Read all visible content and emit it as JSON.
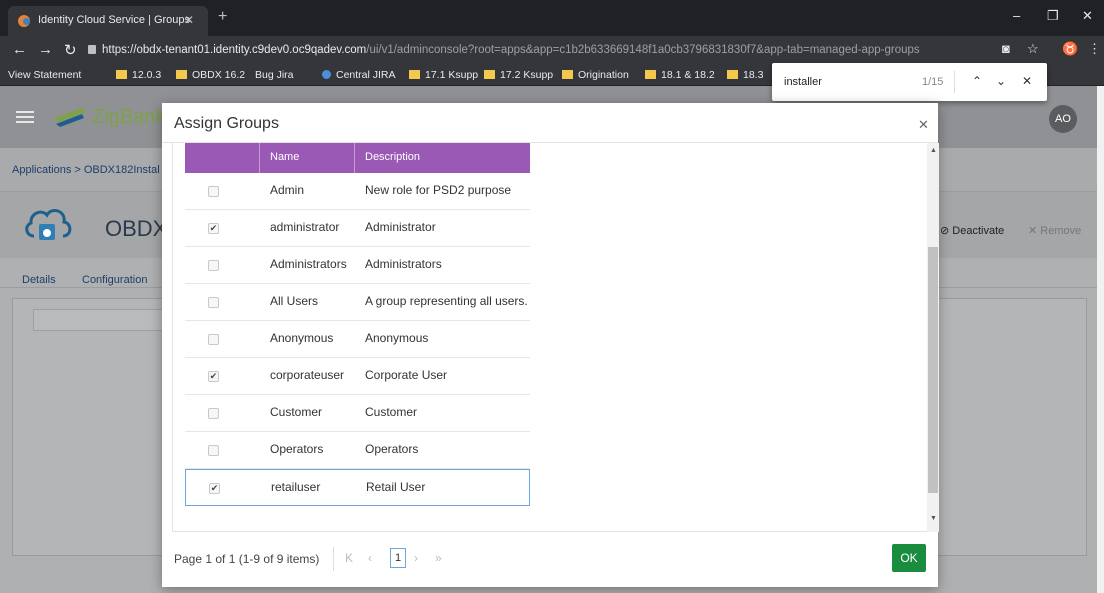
{
  "browser": {
    "tab_title": "Identity Cloud Service | Groups",
    "url_host": "https://obdx-tenant01.identity.c9dev0.oc9qadev.com",
    "url_path": "/ui/v1/adminconsole?root=apps&app=c1b2b633669148f1a0cb3796831830f7&app-tab=managed-app-groups",
    "bookmarks": [
      "View Statement",
      "12.0.3",
      "OBDX 16.2",
      "Bug Jira",
      "Central JIRA",
      "17.1 Ksupp",
      "17.2 Ksupp",
      "Origination",
      "18.1 & 18.2",
      "18.3"
    ],
    "find_query": "installer",
    "find_count": "1/15"
  },
  "app": {
    "logo_text": "ZigBank",
    "avatar": "AO",
    "breadcrumb": "Applications > OBDX182Instal",
    "app_title": "OBDX",
    "deactivate_label": "Deactivate",
    "remove_label": "Remove",
    "tabs": [
      "Details",
      "Configuration"
    ]
  },
  "modal": {
    "title": "Assign Groups",
    "columns": {
      "name": "Name",
      "description": "Description"
    },
    "rows": [
      {
        "name": "Admin",
        "description": "New role for PSD2 purpose",
        "checked": false
      },
      {
        "name": "administrator",
        "description": "Administrator",
        "checked": true
      },
      {
        "name": "Administrators",
        "description": "Administrators",
        "checked": false
      },
      {
        "name": "All Users",
        "description": "A group representing all users.",
        "checked": false
      },
      {
        "name": "Anonymous",
        "description": "Anonymous",
        "checked": false
      },
      {
        "name": "corporateuser",
        "description": "Corporate User",
        "checked": true
      },
      {
        "name": "Customer",
        "description": "Customer",
        "checked": false
      },
      {
        "name": "Operators",
        "description": "Operators",
        "checked": false
      },
      {
        "name": "retailuser",
        "description": "Retail User",
        "checked": true
      }
    ],
    "pager": {
      "text": "Page 1 of 1 (1-9 of 9 items)",
      "current_page": "1"
    },
    "ok_label": "OK"
  },
  "colors": {
    "header_purple": "#9b59b6",
    "ok_green": "#1a8c3e",
    "brand_green": "#7ea14a"
  },
  "icons": [
    "close-icon",
    "back-icon",
    "forward-icon",
    "reload-icon",
    "lock-icon",
    "folder-icon",
    "cloud-app-icon",
    "checkbox-icon",
    "chevron-up-icon",
    "chevron-down-icon"
  ]
}
